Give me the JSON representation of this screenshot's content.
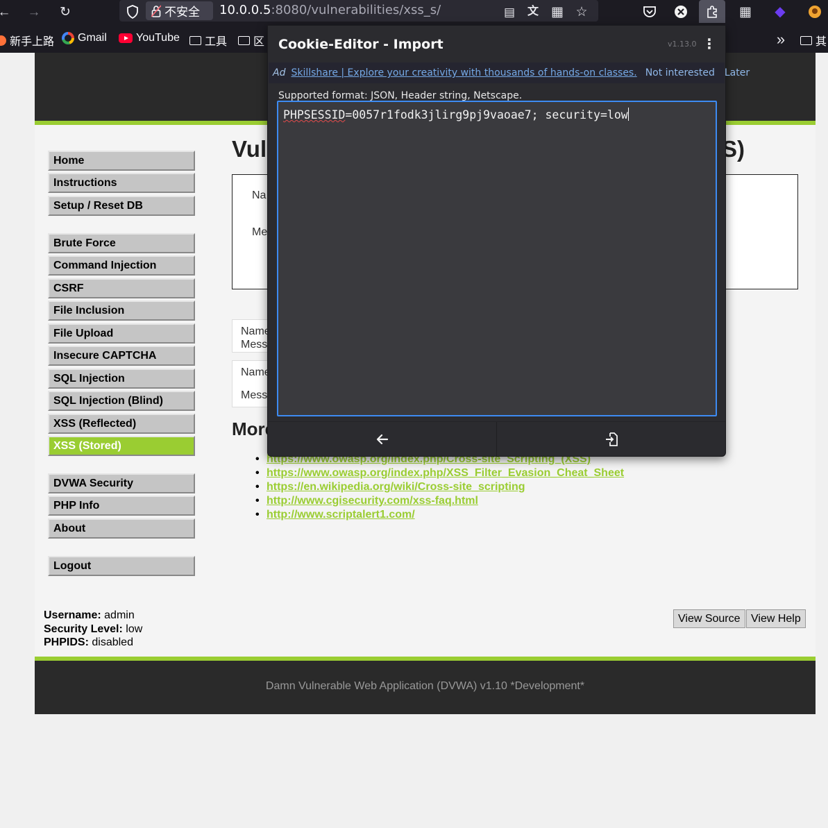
{
  "browser": {
    "security_label": "不安全",
    "url_host": "10.0.0.5",
    "url_rest": ":8080/vulnerabilities/xss_s/"
  },
  "bookmarks": [
    {
      "label": "新手上路",
      "icon": "firefox-icon"
    },
    {
      "label": "Gmail",
      "icon": "google-icon"
    },
    {
      "label": "YouTube",
      "icon": "youtube-icon"
    },
    {
      "label": "工具",
      "icon": "folder-icon"
    },
    {
      "label": "区",
      "icon": "folder-icon"
    },
    {
      "label": "其",
      "icon": "folder-icon"
    }
  ],
  "dvwa": {
    "title_start": "Vul",
    "title_end": "S)",
    "form_name_label": "Na",
    "form_message_label": "Me",
    "entry1_name": "Name",
    "entry1_message": "Mess",
    "entry2_name": "Name",
    "entry2_message": "Mess",
    "more_title": "More",
    "menu": [
      {
        "label": "Home"
      },
      {
        "label": "Instructions"
      },
      {
        "label": "Setup / Reset DB"
      },
      {
        "label": "Brute Force"
      },
      {
        "label": "Command Injection"
      },
      {
        "label": "CSRF"
      },
      {
        "label": "File Inclusion"
      },
      {
        "label": "File Upload"
      },
      {
        "label": "Insecure CAPTCHA"
      },
      {
        "label": "SQL Injection"
      },
      {
        "label": "SQL Injection (Blind)"
      },
      {
        "label": "XSS (Reflected)"
      },
      {
        "label": "XSS (Stored)"
      },
      {
        "label": "DVWA Security"
      },
      {
        "label": "PHP Info"
      },
      {
        "label": "About"
      },
      {
        "label": "Logout"
      }
    ],
    "links": [
      "https://www.owasp.org/index.php/Cross-site_Scripting_(XSS)",
      "https://www.owasp.org/index.php/XSS_Filter_Evasion_Cheat_Sheet",
      "https://en.wikipedia.org/wiki/Cross-site_scripting",
      "http://www.cgisecurity.com/xss-faq.html",
      "http://www.scriptalert1.com/"
    ],
    "status": {
      "username_label": "Username:",
      "username": "admin",
      "security_label": "Security Level:",
      "security": "low",
      "phpids_label": "PHPIDS:",
      "phpids": "disabled"
    },
    "view_source": "View Source",
    "view_help": "View Help",
    "footer": "Damn Vulnerable Web Application (DVWA) v1.10 *Development*"
  },
  "popup": {
    "title": "Cookie-Editor - Import",
    "version": "v1.13.0",
    "ad_tag": "Ad",
    "ad_link": "Skillshare | Explore your creativity with thousands of hands-on classes.",
    "ad_not_interested": "Not interested",
    "ad_later": "Later",
    "hint": "Supported format: JSON, Header string, Netscape.",
    "input_spell": "PHPSESSID",
    "input_rest": "=0057r1fodk3jlirg9pj9vaoae7; security=low"
  }
}
